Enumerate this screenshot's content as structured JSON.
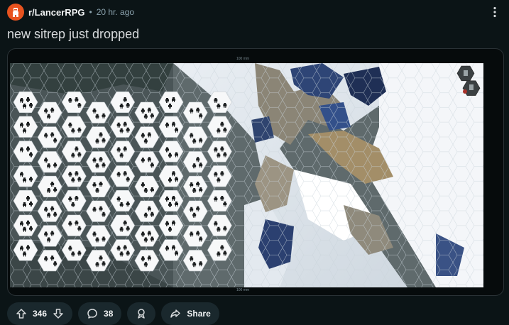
{
  "post": {
    "subreddit": "r/LancerRPG",
    "separator": "•",
    "time": "20 hr. ago",
    "title": "new sitrep just dropped"
  },
  "media": {
    "scale_top": "100 mm",
    "scale_bottom": "100 mm",
    "alt": "Hex battle map over snowy mountain terrain with dozens of mech tokens on the left"
  },
  "actions": {
    "votes": "346",
    "comments": "38",
    "share": "Share"
  },
  "colors": {
    "brand": "#e8531f",
    "background": "#0b1416",
    "pill": "#1a282d"
  },
  "icons": [
    "subreddit-avatar-icon",
    "more-options-icon",
    "upvote-icon",
    "downvote-icon",
    "comment-icon",
    "award-icon",
    "share-icon"
  ]
}
